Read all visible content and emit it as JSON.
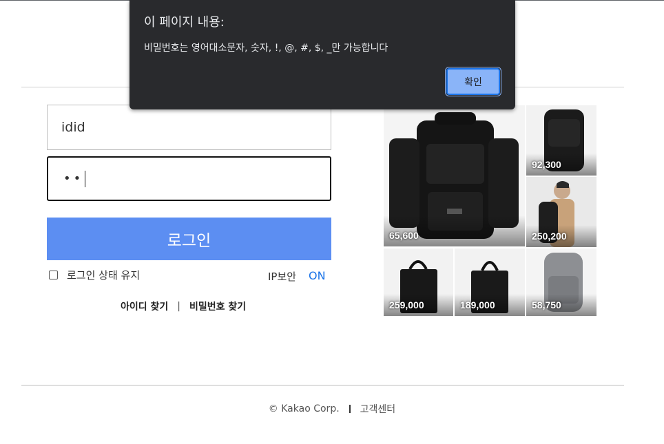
{
  "dialog": {
    "title": "이 페이지 내용:",
    "message": "비밀번호는 영어대소문자, 숫자, !, @, #, $, _만 가능합니다",
    "ok_label": "확인"
  },
  "login": {
    "id_value": "idid",
    "password_mask": "••",
    "login_button": "로그인",
    "keep_login_label": "로그인 상태 유지",
    "ip_security_label": "IP보안",
    "ip_security_state": "ON",
    "find_id": "아이디 찾기",
    "separator": "|",
    "find_password": "비밀번호 찾기"
  },
  "ads": [
    {
      "name": "tactical-backpack-ad",
      "price": "65,600"
    },
    {
      "name": "black-backpack-ad",
      "price": "92,300"
    },
    {
      "name": "model-backpack-ad",
      "price": "250,200"
    },
    {
      "name": "black-tote-ad",
      "price": "259,000"
    },
    {
      "name": "black-tote-2-ad",
      "price": "189,000"
    },
    {
      "name": "gray-backpack-ad",
      "price": "58,750"
    }
  ],
  "footer": {
    "copyright": "© Kakao Corp.",
    "customer_center": "고객센터"
  },
  "colors": {
    "login_button": "#5c8ef2",
    "ip_on": "#1a73e8",
    "dialog_bg": "#292a2d",
    "dialog_button": "#8ab4f8"
  }
}
